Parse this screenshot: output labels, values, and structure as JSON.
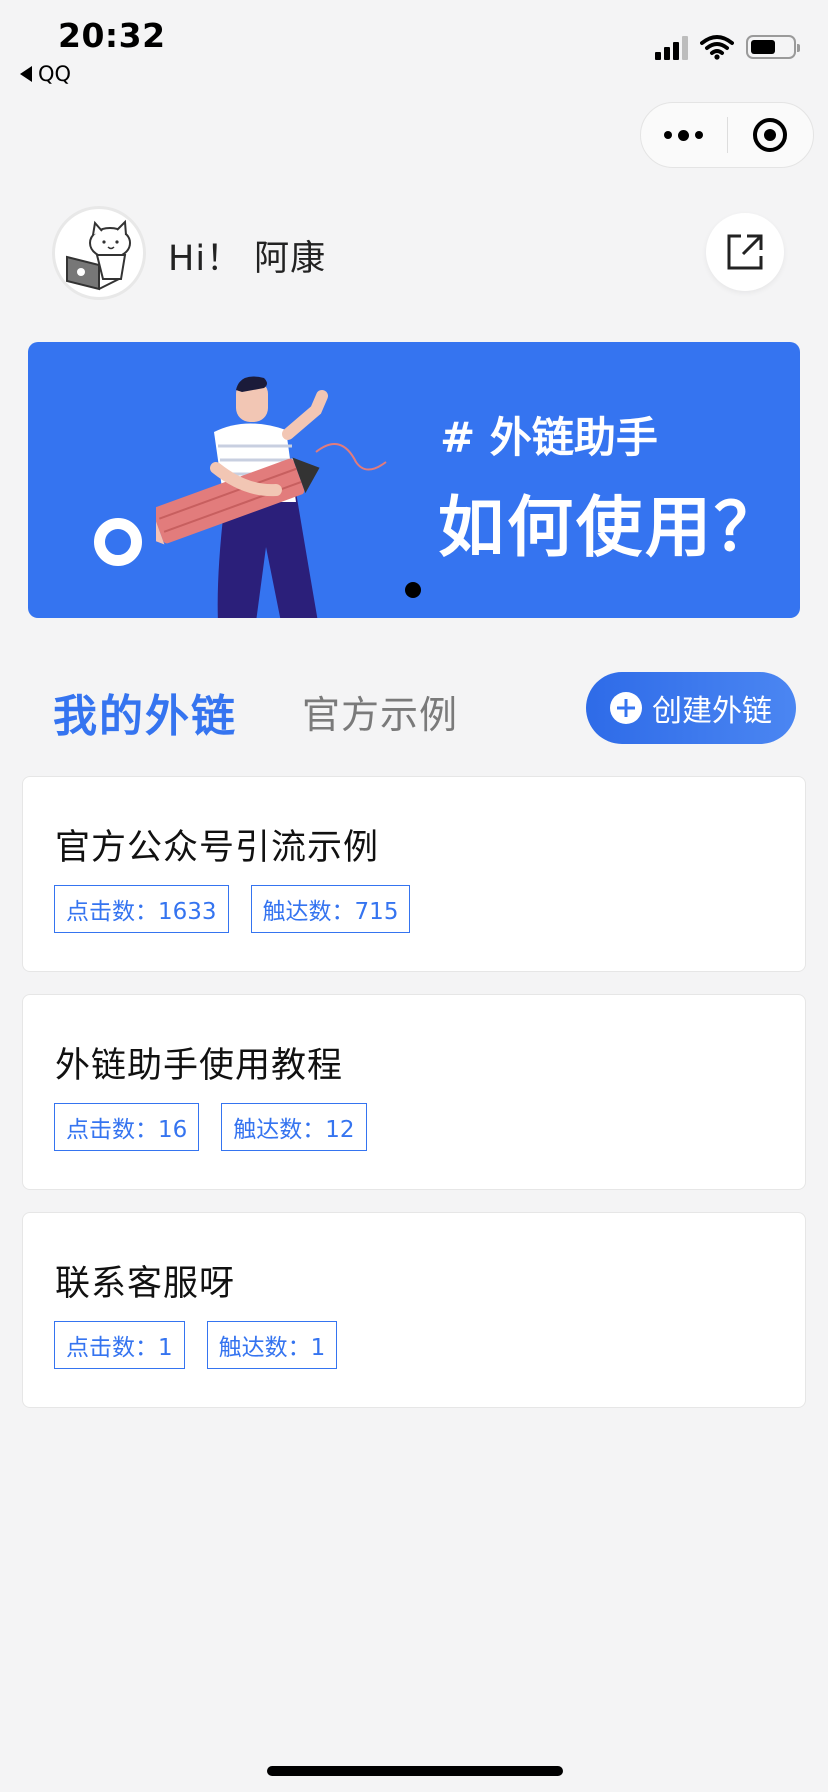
{
  "status_bar": {
    "time": "20:32",
    "back_app": "QQ"
  },
  "header": {
    "greeting": "Hi！ 阿康"
  },
  "banner": {
    "tag": "# 外链助手",
    "headline": "如何使用？",
    "accent_color": "#3574f0"
  },
  "tabs": [
    {
      "label": "我的外链",
      "active": true
    },
    {
      "label": "官方示例",
      "active": false
    }
  ],
  "create_button": {
    "label": "创建外链"
  },
  "links": [
    {
      "title": "官方公众号引流示例",
      "clicks": "点击数：1633",
      "reach": "触达数：715"
    },
    {
      "title": "外链助手使用教程",
      "clicks": "点击数：16",
      "reach": "触达数：12"
    },
    {
      "title": "联系客服呀",
      "clicks": "点击数：1",
      "reach": "触达数：1"
    }
  ]
}
